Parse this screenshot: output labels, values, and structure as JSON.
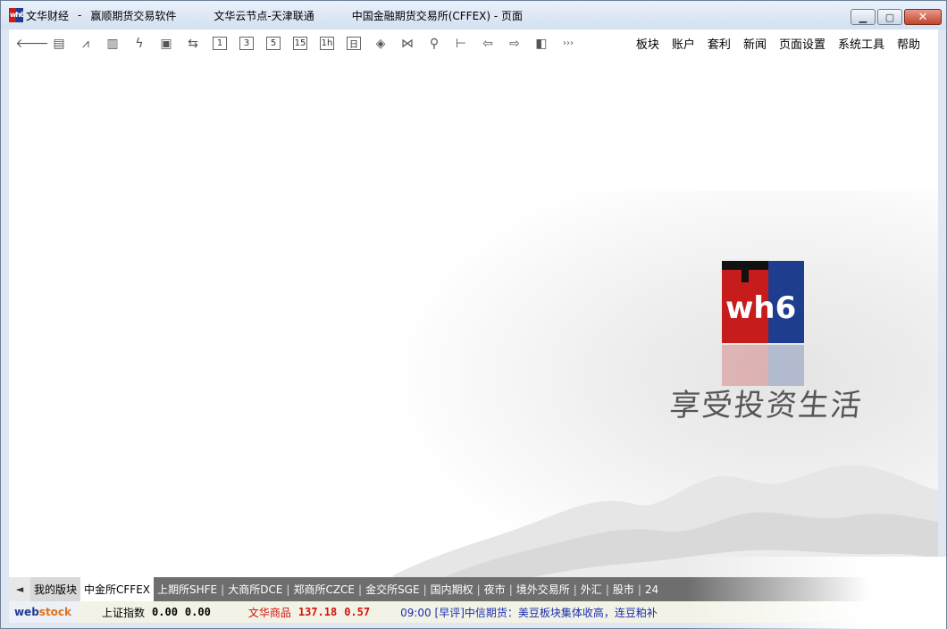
{
  "window": {
    "title_parts": [
      "文华财经",
      "-",
      "赢顺期货交易软件",
      "文华云节点-天津联通",
      "中国金融期货交易所(CFFEX) - 页面"
    ],
    "logo_text": "wh6",
    "buttons": {
      "minimize": "▁",
      "maximize": "▢",
      "close": "✕"
    }
  },
  "toolbar": {
    "icons": [
      {
        "name": "back-arrow-icon",
        "glyph": "🡐"
      },
      {
        "name": "quote-list-icon",
        "glyph": "▤"
      },
      {
        "name": "line-chart-icon",
        "glyph": "⩘"
      },
      {
        "name": "candlestick-icon",
        "glyph": "▥"
      },
      {
        "name": "lightning-icon",
        "glyph": "ϟ"
      },
      {
        "name": "save-icon",
        "glyph": "▣"
      },
      {
        "name": "switch-icon",
        "glyph": "⇆"
      }
    ],
    "period_buttons": [
      "1",
      "3",
      "5",
      "15",
      "1h",
      "日"
    ],
    "tool_icons": [
      {
        "name": "tick-chart-icon",
        "glyph": "◈"
      },
      {
        "name": "compare-icon",
        "glyph": "⋈"
      },
      {
        "name": "search-icon",
        "glyph": "⚲"
      },
      {
        "name": "fit-width-icon",
        "glyph": "⊢"
      },
      {
        "name": "page-left-icon",
        "glyph": "⇦"
      },
      {
        "name": "page-right-icon",
        "glyph": "⇨"
      },
      {
        "name": "panel-icon",
        "glyph": "◧"
      },
      {
        "name": "more-icon",
        "glyph": "›››"
      }
    ],
    "menus": [
      "板块",
      "账户",
      "套利",
      "新闻",
      "页面设置",
      "系统工具",
      "帮助"
    ]
  },
  "splash": {
    "logo_text": "wh6",
    "slogan": "享受投资生活",
    "colors": {
      "red": "#c61c1c",
      "blue": "#1e3d8f"
    }
  },
  "tabs": {
    "scroll_left": "◄",
    "items": [
      "我的版块",
      "中金所CFFEX",
      "上期所SHFE",
      "大商所DCE",
      "郑商所CZCE",
      "金交所SGE",
      "国内期权",
      "夜市",
      "境外交易所",
      "外汇",
      "股市",
      "24"
    ],
    "active_index": 1
  },
  "status": {
    "brand": {
      "web": "web",
      "stock": "stock"
    },
    "index1": {
      "name": "上证指数",
      "value": "0.00",
      "change": "0.00"
    },
    "index2": {
      "name": "文华商品",
      "value": "137.18",
      "change": "0.57"
    },
    "news": "09:00 [早评]中信期货：美豆板块集体收高，连豆粕补"
  }
}
